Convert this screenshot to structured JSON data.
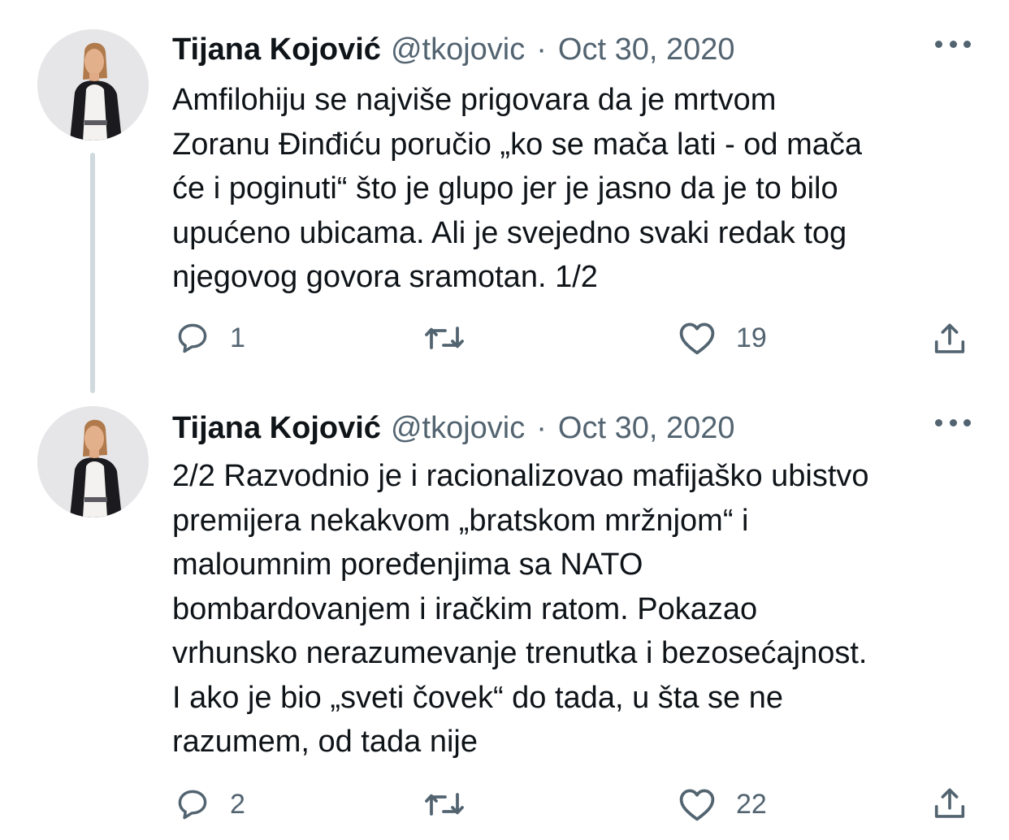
{
  "tweets": [
    {
      "author": "Tijana Kojović",
      "handle": "@tkojovic",
      "separator": "·",
      "date": "Oct 30, 2020",
      "lines": [
        "Amfilohiju se najviše prigovara da je mrtvom",
        "Zoranu Đinđiću poručio „ko se mača lati - od mača",
        "će i poginuti“ što je glupo jer je jasno da je to bilo",
        "upućeno ubicama. Ali je svejedno svaki redak tog",
        "njegovog govora sramotan. 1/2"
      ],
      "replies": "1",
      "retweets": "",
      "likes": "19"
    },
    {
      "author": "Tijana Kojović",
      "handle": "@tkojovic",
      "separator": "·",
      "date": "Oct 30, 2020",
      "lines": [
        "2/2 Razvodnio je i racionalizovao mafijaško ubistvo",
        "premijera nekakvom „bratskom mržnjom“ i",
        "maloumnim poređenjima sa NATO",
        "bombardovanjem i iračkim ratom. Pokazao",
        "vrhunsko nerazumevanje trenutka i bezosećajnost.",
        "I ako je bio „sveti čovek“ do tada, u šta se ne",
        "razumem, od tada nije"
      ],
      "replies": "2",
      "retweets": "",
      "likes": "22"
    }
  ],
  "icons": {
    "reply": "reply-icon",
    "retweet": "retweet-icon",
    "like": "heart-icon",
    "share": "share-icon",
    "more": "more-icon"
  },
  "colors": {
    "text": "#0f1419",
    "secondary": "#536471",
    "thread_line": "#cfd9de",
    "background": "#ffffff"
  }
}
